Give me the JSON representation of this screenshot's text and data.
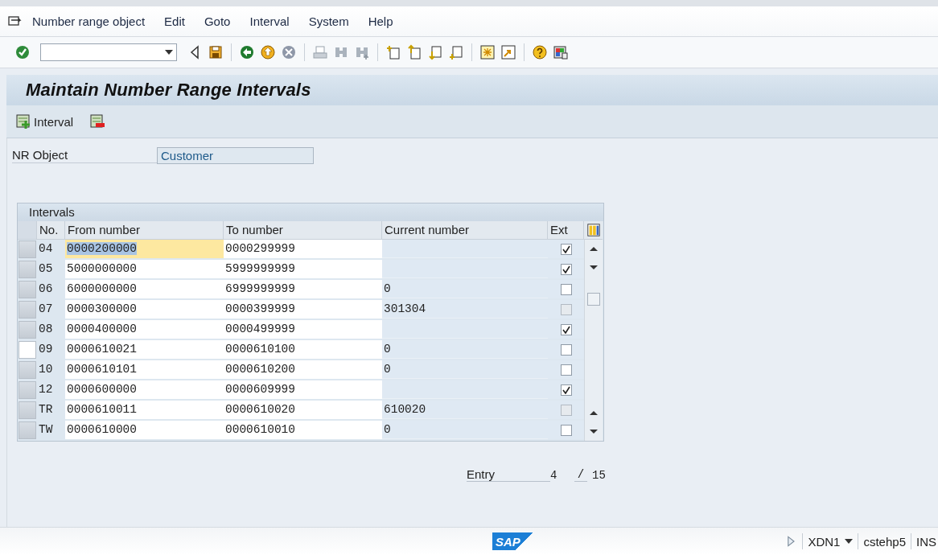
{
  "menu": [
    {
      "label": "Number range object"
    },
    {
      "label": "Edit"
    },
    {
      "label": "Goto"
    },
    {
      "label": "Interval"
    },
    {
      "label": "System"
    },
    {
      "label": "Help"
    }
  ],
  "title": "Maintain Number Range Intervals",
  "app_toolbar": {
    "interval_button": "Interval"
  },
  "nr_object": {
    "label": "NR Object",
    "value": "Customer"
  },
  "table": {
    "title": "Intervals",
    "columns": [
      "No.",
      "From number",
      "To number",
      "Current number",
      "Ext"
    ],
    "rows": [
      {
        "no": "04",
        "from": "0000200000",
        "to": "0000299999",
        "checked": true,
        "disabled": false,
        "selected": false,
        "focused": true
      },
      {
        "no": "05",
        "from": "5000000000",
        "to": "5999999999",
        "checked": true,
        "disabled": false,
        "selected": false,
        "focused": false
      },
      {
        "no": "06",
        "from": "6000000000",
        "to": "6999999999",
        "current": "0",
        "checked": false,
        "disabled": false,
        "selected": false,
        "focused": false
      },
      {
        "no": "07",
        "from": "0000300000",
        "to": "0000399999",
        "current": "301304",
        "checked": false,
        "disabled": true,
        "selected": false,
        "focused": false
      },
      {
        "no": "08",
        "from": "0000400000",
        "to": "0000499999",
        "checked": true,
        "disabled": false,
        "selected": false,
        "focused": false
      },
      {
        "no": "09",
        "from": "0000610021",
        "to": "0000610100",
        "current": "0",
        "checked": false,
        "disabled": false,
        "selected": true,
        "focused": false
      },
      {
        "no": "10",
        "from": "0000610101",
        "to": "0000610200",
        "current": "0",
        "checked": false,
        "disabled": false,
        "selected": false,
        "focused": false
      },
      {
        "no": "12",
        "from": "0000600000",
        "to": "0000609999",
        "checked": true,
        "disabled": false,
        "selected": false,
        "focused": false
      },
      {
        "no": "TR",
        "from": "0000610011",
        "to": "0000610020",
        "current": "610020",
        "checked": false,
        "disabled": true,
        "selected": false,
        "focused": false
      },
      {
        "no": "TW",
        "from": "0000610000",
        "to": "0000610010",
        "current": "0",
        "checked": false,
        "disabled": false,
        "selected": false,
        "focused": false
      }
    ]
  },
  "entry": {
    "label": "Entry",
    "current": "4",
    "separator": "/",
    "total": "15"
  },
  "status_bar": {
    "logo": "SAP",
    "system": "XDN1",
    "client": "cstehp5",
    "mode": "INS"
  }
}
